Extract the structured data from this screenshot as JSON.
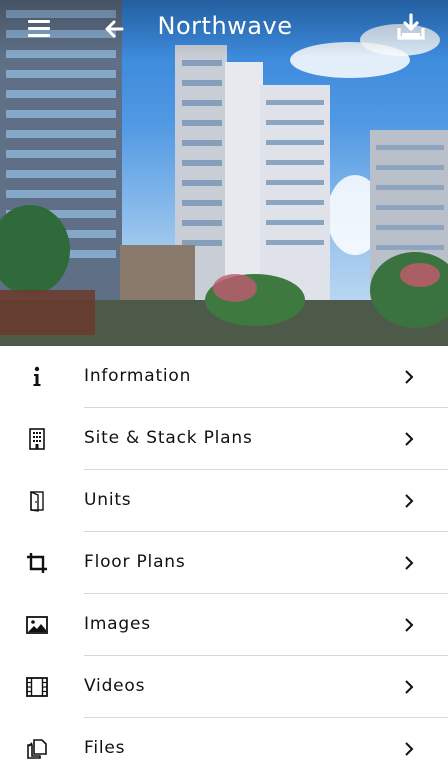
{
  "header": {
    "title": "Northwave",
    "menu_icon": "hamburger-menu-icon",
    "back_icon": "arrow-left-icon",
    "download_icon": "download-icon"
  },
  "hero": {
    "description_icon": "building-photo"
  },
  "menu": {
    "items": [
      {
        "label": "Information",
        "icon": "info-icon"
      },
      {
        "label": "Site & Stack Plans",
        "icon": "building-icon"
      },
      {
        "label": "Units",
        "icon": "door-icon"
      },
      {
        "label": "Floor Plans",
        "icon": "crop-icon"
      },
      {
        "label": "Images",
        "icon": "image-icon"
      },
      {
        "label": "Videos",
        "icon": "film-icon"
      },
      {
        "label": "Files",
        "icon": "files-icon"
      }
    ],
    "chevron_icon": "chevron-right-icon"
  },
  "colors": {
    "header_text": "#ffffff",
    "divider": "#d8d8d8",
    "text": "#111111"
  }
}
